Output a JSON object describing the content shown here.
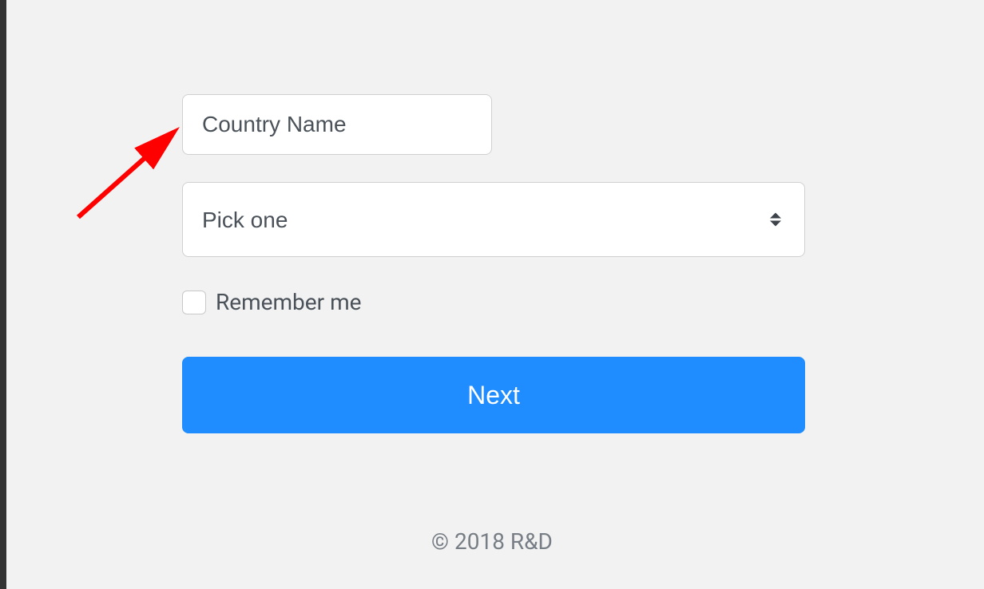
{
  "form": {
    "country_input": {
      "placeholder": "Country Name",
      "value": ""
    },
    "select": {
      "placeholder": "Pick one"
    },
    "remember": {
      "label": "Remember me",
      "checked": false
    },
    "next_button_label": "Next"
  },
  "footer": {
    "copyright": "© 2018 R&D"
  }
}
